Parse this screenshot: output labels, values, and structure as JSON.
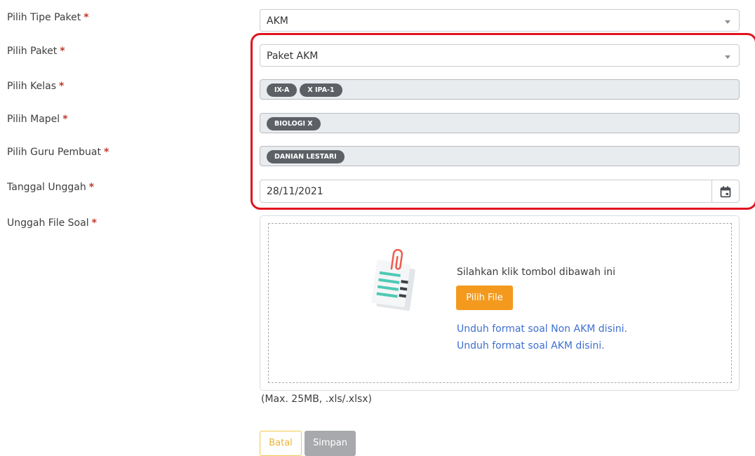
{
  "form": {
    "required_mark": "*",
    "tipe_paket": {
      "label": "Pilih Tipe Paket",
      "value": "AKM"
    },
    "paket": {
      "label": "Pilih Paket",
      "value": "Paket AKM"
    },
    "kelas": {
      "label": "Pilih Kelas",
      "chips": [
        "IX-A",
        "X IPA-1"
      ]
    },
    "mapel": {
      "label": "Pilih Mapel",
      "chips": [
        "BIOLOGI X"
      ]
    },
    "guru": {
      "label": "Pilih Guru Pembuat",
      "chips": [
        "DANIAN LESTARI"
      ]
    },
    "tanggal": {
      "label": "Tanggal Unggah",
      "value": "28/11/2021"
    },
    "file": {
      "label": "Unggah File Soal"
    }
  },
  "upload": {
    "instruction": "Silahkan klik tombol dibawah ini",
    "pick_button": "Pilih File",
    "link_non_akm": "Unduh format soal Non AKM disini.",
    "link_akm": "Unduh format soal AKM disini.",
    "hint": "(Max. 25MB, .xls/.xlsx)"
  },
  "actions": {
    "cancel": "Batal",
    "save": "Simpan"
  },
  "colors": {
    "highlight": "#e0141e",
    "accent": "#f39a1e",
    "chip": "#5d6166",
    "link": "#3f6fd1"
  },
  "icons": [
    "calendar-icon",
    "document-clip-icon",
    "chevron-down-icon"
  ]
}
